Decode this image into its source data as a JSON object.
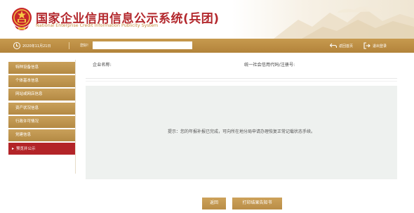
{
  "header": {
    "title_cn": "国家企业信用信息公示系统(兵团)",
    "title_en": "National Enterprise Credit Information Publicity System",
    "colors": {
      "title": "#b3282d",
      "accent": "#c9a05a",
      "active": "#b32428"
    }
  },
  "toolbar": {
    "date": "2020年11月21日",
    "user_label": "您好!",
    "user_value": "",
    "back_home": "返回首页",
    "logout": "退出登录"
  },
  "sidebar": {
    "items": [
      {
        "label": "特种设备信息",
        "active": false
      },
      {
        "label": "个体基本信息",
        "active": false
      },
      {
        "label": "网站或网店信息",
        "active": false
      },
      {
        "label": "资产状况信息",
        "active": false
      },
      {
        "label": "行政许可情况",
        "active": false
      },
      {
        "label": "党建信息",
        "active": false
      },
      {
        "label": "预览并公示",
        "active": true
      }
    ]
  },
  "main": {
    "company_label": "企业名称:",
    "company_value": "",
    "credit_code_label": "统一社会信用代码/注册号:",
    "credit_code_value": "",
    "notice": "提示：您的年报补报已完成，可向所在地分局申请办理恢复正常记载状态手续。"
  },
  "buttons": {
    "back": "返回",
    "print": "打印结果告知书"
  }
}
